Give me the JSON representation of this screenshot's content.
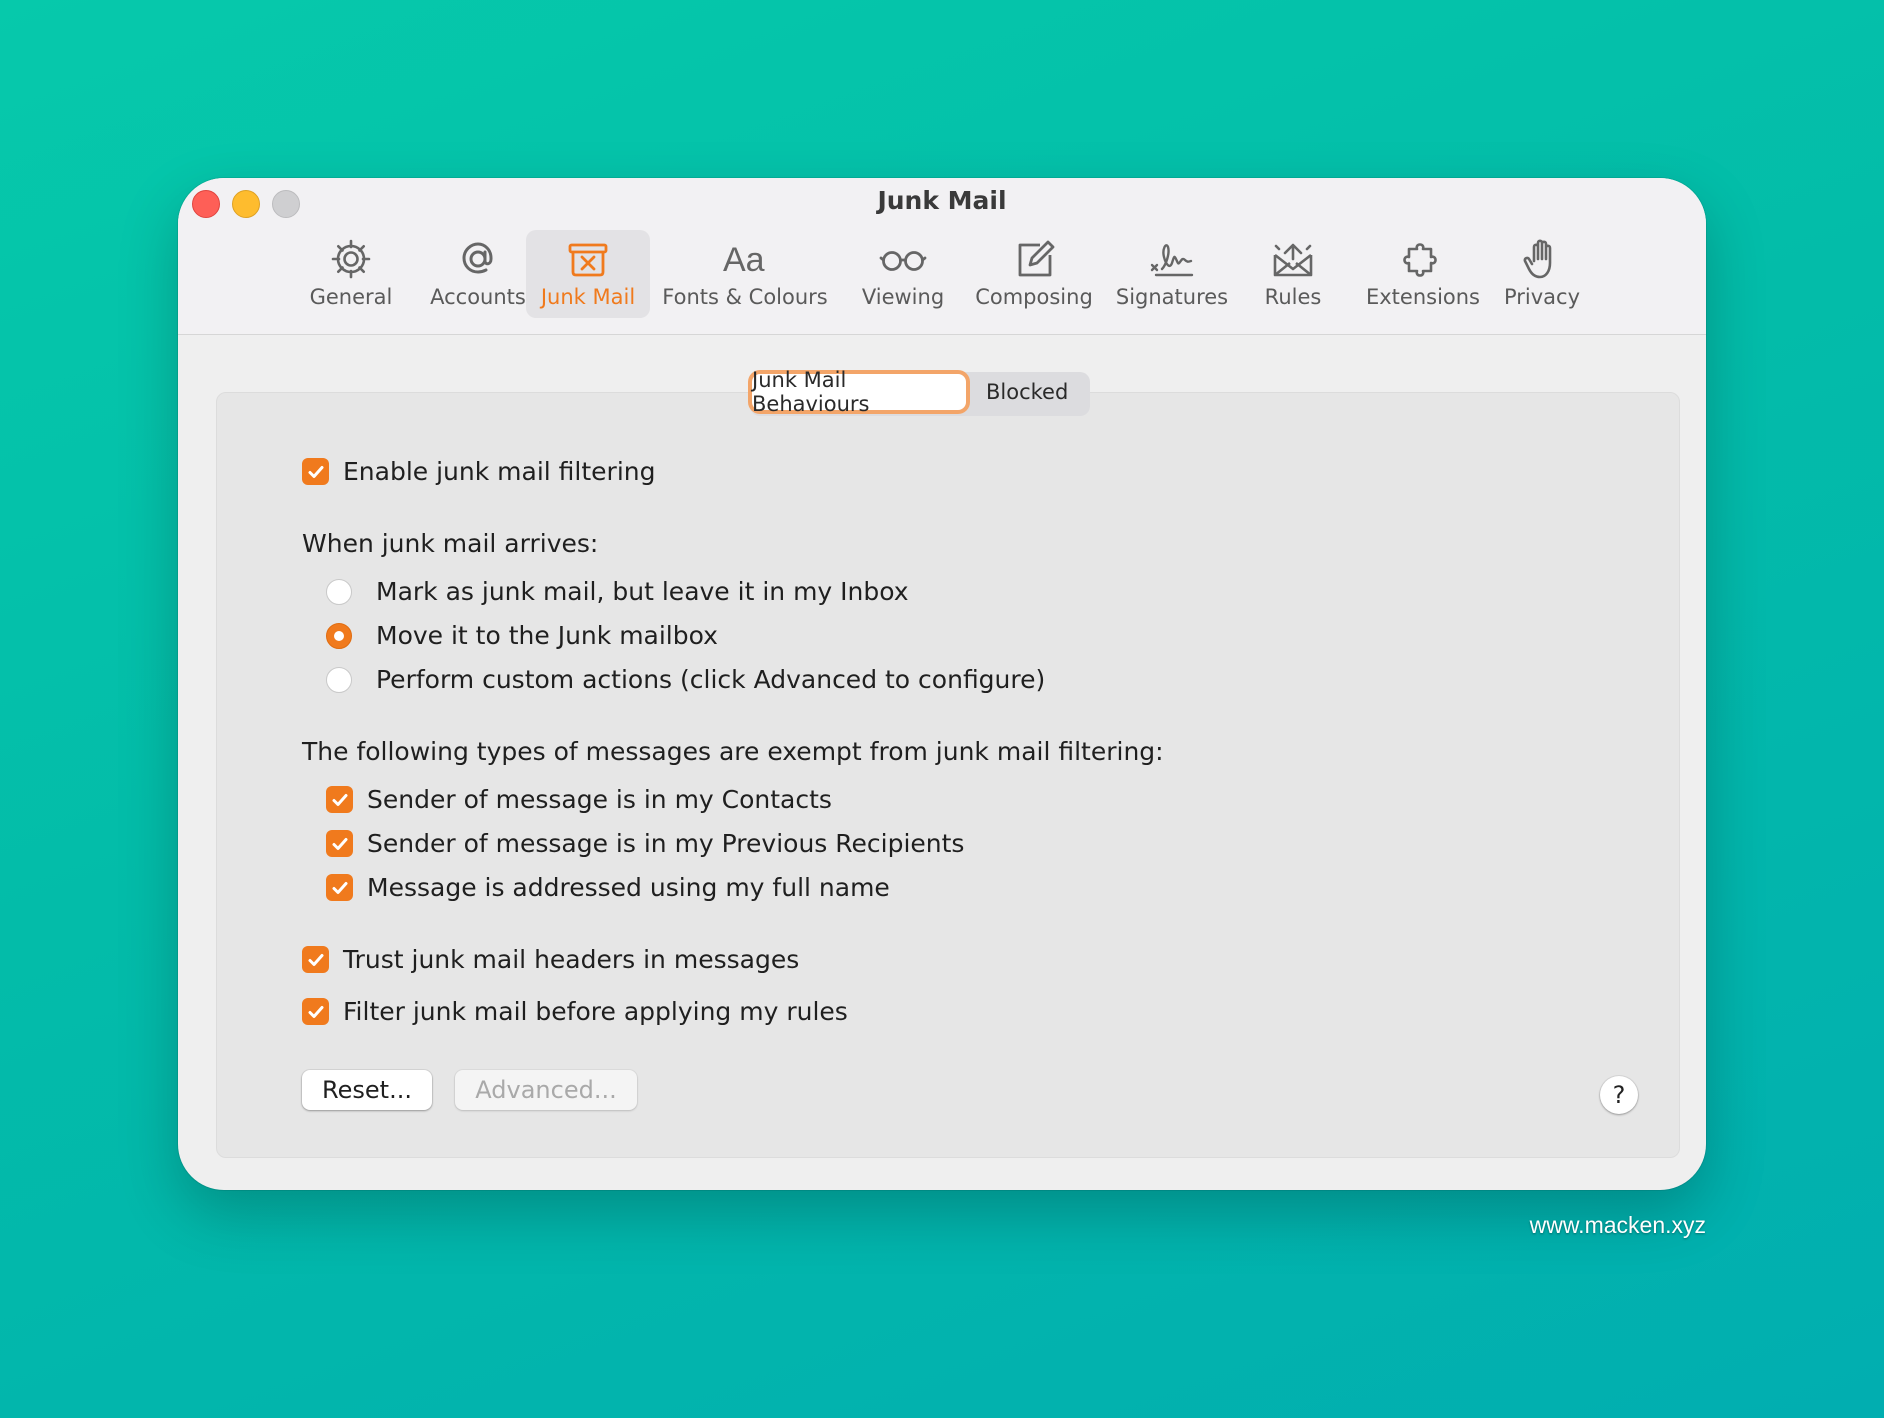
{
  "window": {
    "title": "Junk Mail"
  },
  "toolbar": {
    "tabs": [
      {
        "label": "General",
        "icon": "gear-icon",
        "active": false
      },
      {
        "label": "Accounts",
        "icon": "at-sign-icon",
        "active": false
      },
      {
        "label": "Junk Mail",
        "icon": "junk-bin-icon",
        "active": true
      },
      {
        "label": "Fonts & Colours",
        "icon": "font-aa-icon",
        "active": false
      },
      {
        "label": "Viewing",
        "icon": "glasses-icon",
        "active": false
      },
      {
        "label": "Composing",
        "icon": "compose-pencil-icon",
        "active": false
      },
      {
        "label": "Signatures",
        "icon": "signature-icon",
        "active": false
      },
      {
        "label": "Rules",
        "icon": "envelope-rules-icon",
        "active": false
      },
      {
        "label": "Extensions",
        "icon": "puzzle-icon",
        "active": false
      },
      {
        "label": "Privacy",
        "icon": "hand-icon",
        "active": false
      }
    ]
  },
  "segments": {
    "behaviours": "Junk Mail Behaviours",
    "blocked": "Blocked",
    "selected": "Junk Mail Behaviours"
  },
  "settings": {
    "enable_filtering": {
      "label": "Enable junk mail filtering",
      "checked": true
    },
    "arrival_heading": "When junk mail arrives:",
    "arrival_options": [
      {
        "label": "Mark as junk mail, but leave it in my Inbox",
        "selected": false
      },
      {
        "label": "Move it to the Junk mailbox",
        "selected": true
      },
      {
        "label": "Perform custom actions (click Advanced to configure)",
        "selected": false
      }
    ],
    "exempt_heading": "The following types of messages are exempt from junk mail filtering:",
    "exempt_options": [
      {
        "label": "Sender of message is in my Contacts",
        "checked": true
      },
      {
        "label": "Sender of message is in my Previous Recipients",
        "checked": true
      },
      {
        "label": "Message is addressed using my full name",
        "checked": true
      }
    ],
    "trust_headers": {
      "label": "Trust junk mail headers in messages",
      "checked": true
    },
    "filter_before_rules": {
      "label": "Filter junk mail before applying my rules",
      "checked": true
    }
  },
  "buttons": {
    "reset": "Reset...",
    "advanced": "Advanced...",
    "help": "?"
  },
  "watermark": "www.macken.xyz",
  "colors": {
    "accent": "#f07a1d",
    "background": "#03bca9"
  }
}
